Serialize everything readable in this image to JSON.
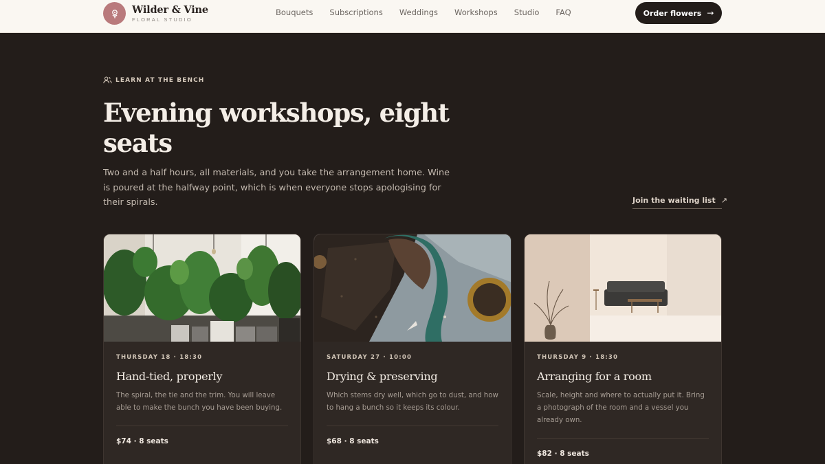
{
  "brand": {
    "name": "Wilder & Vine",
    "subtitle": "FLORAL STUDIO"
  },
  "nav": [
    "Bouquets",
    "Subscriptions",
    "Weddings",
    "Workshops",
    "Studio",
    "FAQ"
  ],
  "cta": {
    "label": "Order flowers",
    "icon": "arrow-right-icon"
  },
  "hero": {
    "eyebrow": "LEARN AT THE BENCH",
    "eyebrow_icon": "users-icon",
    "title": "Evening workshops, eight seats",
    "lede": "Two and a half hours, all materials, and you take the arrangement home. Wine is poured at the halfway point, which is when everyone stops apologising for their spirals.",
    "waitlist": "Join the waiting list",
    "waitlist_icon": "arrow-up-right-icon"
  },
  "cards": [
    {
      "meta": "THURSDAY 18 · 18:30",
      "title": "Hand-tied, properly",
      "desc": "The spiral, the tie and the trim. You will leave able to make the bunch you have been buying.",
      "price": "$74 · 8 seats",
      "image": "houseplants-image"
    },
    {
      "meta": "SATURDAY 27 · 10:00",
      "title": "Drying & preserving",
      "desc": "Which stems dry well, which go to dust, and how to hang a bunch so it keeps its colour.",
      "price": "$68 · 8 seats",
      "image": "soil-trowel-image"
    },
    {
      "meta": "THURSDAY 9 · 18:30",
      "title": "Arranging for a room",
      "desc": "Scale, height and where to actually put it. Bring a photograph of the room and a vessel you already own.",
      "price": "$82 · 8 seats",
      "image": "living-room-image"
    }
  ],
  "colors": {
    "background": "#231d1a",
    "header": "#faf7f2",
    "logo": "#b97a7c",
    "card": "#2f2824"
  }
}
